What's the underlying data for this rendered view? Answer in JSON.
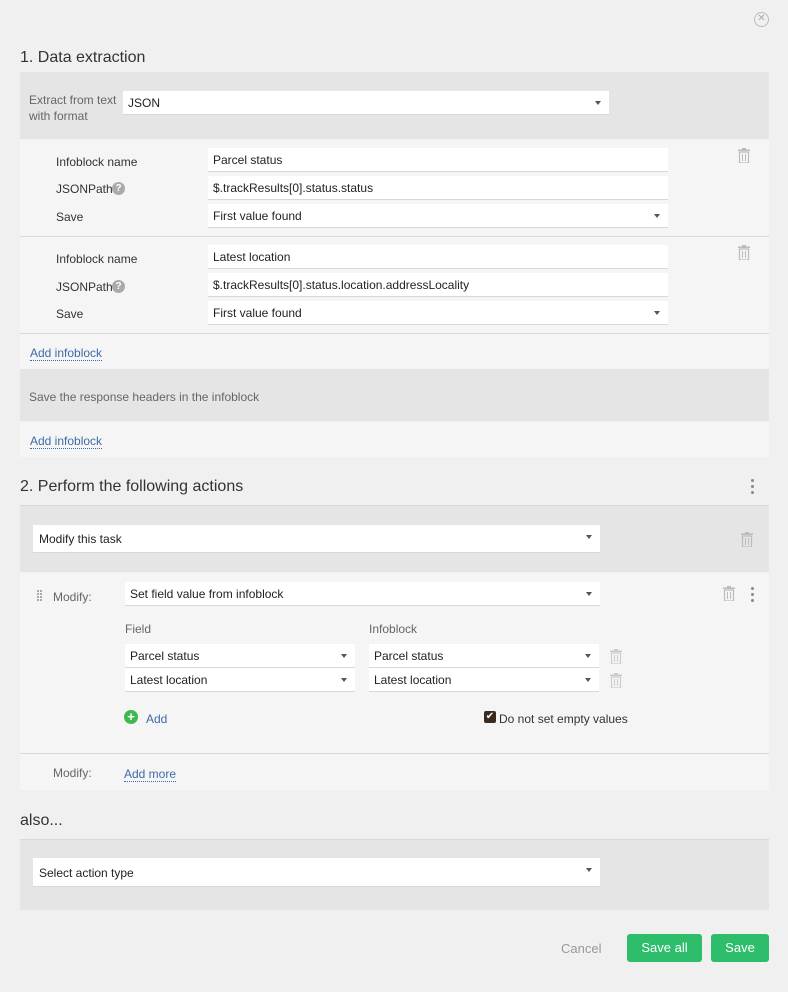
{
  "dialog": {
    "close_icon": "close-circle-icon"
  },
  "section1": {
    "title": "1. Data extraction",
    "format_label": "Extract from text with format",
    "format_value": "JSON",
    "infoblocks": [
      {
        "name_label": "Infoblock name",
        "name_value": "Parcel status",
        "path_label": "JSONPath",
        "path_value": "$.trackResults[0].status.status",
        "save_label": "Save",
        "save_value": "First value found"
      },
      {
        "name_label": "Infoblock name",
        "name_value": "Latest location",
        "path_label": "JSONPath",
        "path_value": "$.trackResults[0].status.location.addressLocality",
        "save_label": "Save",
        "save_value": "First value found"
      }
    ],
    "add_infoblock": "Add infoblock",
    "headers_label": "Save the response headers in the infoblock",
    "add_infoblock_2": "Add infoblock"
  },
  "section2": {
    "title": "2. Perform the following actions",
    "action_select": "Modify this task",
    "modify_label": "Modify:",
    "modify_select": "Set field value from infoblock",
    "field_header": "Field",
    "infoblock_header": "Infoblock",
    "rows": [
      {
        "field": "Parcel status",
        "infoblock": "Parcel status"
      },
      {
        "field": "Latest location",
        "infoblock": "Latest location"
      }
    ],
    "add_label": "Add",
    "empty_values_label": "Do not set empty values",
    "empty_values_checked": true,
    "modify_label_2": "Modify:",
    "add_more": "Add more"
  },
  "also": {
    "title": "also...",
    "action_type_placeholder": "Select action type"
  },
  "footer": {
    "cancel": "Cancel",
    "save_all": "Save all",
    "save": "Save"
  },
  "colors": {
    "primary_button": "#2ebd6b",
    "link": "#3d6aa8",
    "panel": "#e5e5e5"
  }
}
